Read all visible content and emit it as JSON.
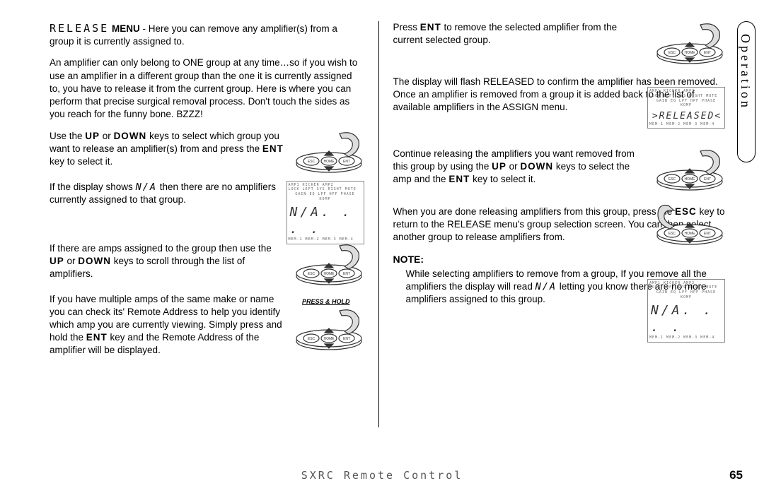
{
  "side_tab": "Operation",
  "footer": {
    "title": "SXRC Remote Control",
    "page": "65"
  },
  "release_menu_label": "RELEASE",
  "left_col": {
    "p1_menu": "MENU",
    "p1": " - Here you can remove any amplifier(s) from a group it is currently assigned to.",
    "p2": "An amplifier can only belong to ONE group at any time…so if you wish to use an amplifier in a different group than the one it is currently assigned to, you have to release it from the current group. Here is where you can perform that precise surgical removal process. Don't touch the sides as you reach for the funny bone. BZZZ!",
    "p3a": "Use the ",
    "p3b": " or ",
    "p3c": " keys to select which group you want to release an amplifier(s) from and press the ",
    "p3d": " key to select it.",
    "key_up": "UP",
    "key_down": "DOWN",
    "key_ent": "ENT",
    "p4a": "If the display shows ",
    "seg_na": "N/A",
    "p4b": " then there are no amplifiers currently assigned to that group.",
    "p5a": "If there are amps assigned to the group then use the ",
    "p5b": " or ",
    "p5c": " keys to scroll through the list of amplifiers.",
    "p6a": "If you have multiple amps of the same make or name you can check its' Remote Address to help you identify which amp you are currently viewing. Simply press and hold the ",
    "p6b": " key and the Remote Address of the amplifier will be displayed.",
    "press_hold": "PRESS & HOLD"
  },
  "right_col": {
    "p1a": "Press ",
    "p1b": " to remove the selected amplifier from the current selected group.",
    "key_ent": "ENT",
    "p2a": "The display will flash RELEASED to confirm the amplifier has been removed. Once an amplifier is removed from a group it is added back to the list of available amplifiers in the ASSIGN menu.",
    "p3a": "Continue releasing the amplifiers you want removed from  this group by using the ",
    "key_up": "UP",
    "p3b": " or ",
    "key_down": "DOWN",
    "p3c": " keys to select the amp and the ",
    "p3d": " key to select it.",
    "p4a": "When you are done releasing amplifiers from this group, press the ",
    "key_esc": "ESC",
    "p4b": " key to return to the RELEASE menu's group selection screen. You can then select another group to release amplifiers from.",
    "note_heading": "NOTE:",
    "note_a": "While selecting amplifiers to remove from a group, If you remove all the amplifiers the display will read ",
    "seg_na": "N/A",
    "note_b": " letting you know there are no more amplifiers assigned to this group."
  },
  "lcd": {
    "top_labels": "AMP1  KICKER  AMP2",
    "row2": "LOCK LEFT SYS RIGHT MUTE",
    "row3": "GAIN EQ LPF HPF PHASE KOMP",
    "na_big": "N/A.  .  .  .",
    "released_big": ">RELEASED<",
    "bottom": "MEM-1 MEM-2 MEM-3 MEM-4"
  },
  "remote_btns": {
    "esc": "ESC",
    "home": "HOME",
    "ent": "ENT"
  }
}
